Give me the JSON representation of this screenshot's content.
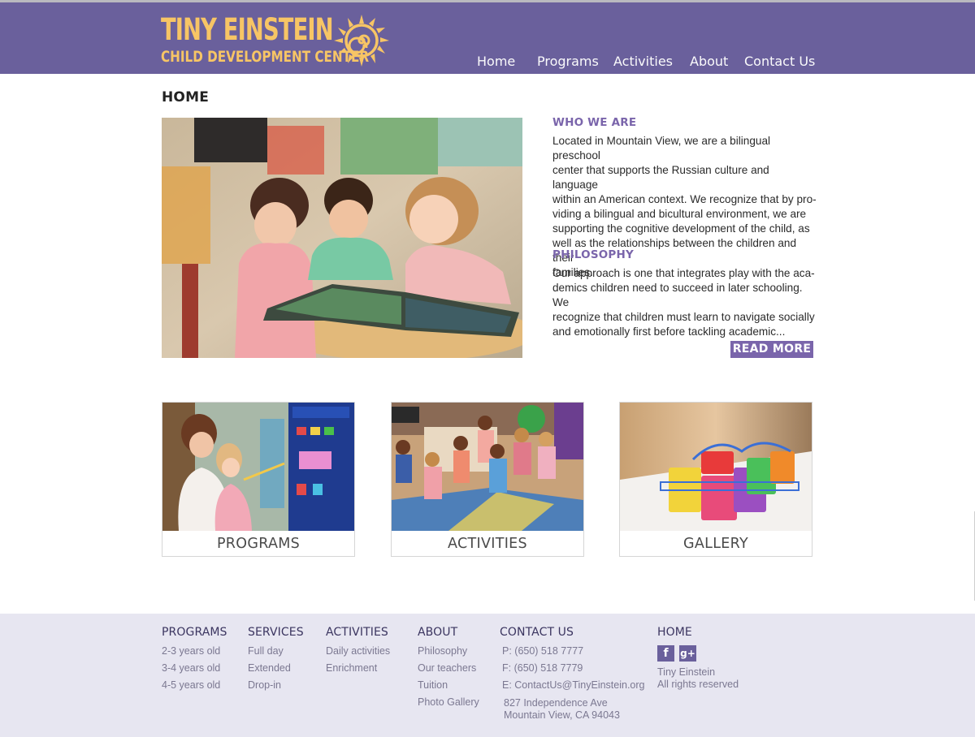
{
  "brand": {
    "name_line1": "TINY EINSTEIN",
    "name_line2": "CHILD DEVELOPMENT CENTER",
    "colors": {
      "header_bg": "#6a609c",
      "logo_gold": "#f7c565",
      "accent": "#7a65ab",
      "footer_bg": "#e7e6f1"
    }
  },
  "nav": {
    "items": [
      {
        "label": "Home"
      },
      {
        "label": "Programs"
      },
      {
        "label": "Activities"
      },
      {
        "label": "About"
      },
      {
        "label": "Contact Us"
      }
    ]
  },
  "main": {
    "title": "HOME",
    "who": {
      "heading": "WHO WE ARE",
      "lines": [
        "Located in Mountain View, we are a bilingual preschool",
        "center that supports the Russian culture and language",
        "within an American context. We recognize that by pro-",
        "viding a bilingual and bicultural environment, we are",
        "supporting the cognitive development of the child, as",
        "well as the relationships between the children and their",
        "families."
      ]
    },
    "philosophy": {
      "heading": "PHILOSOPHY",
      "lines": [
        "Our approach is one that integrates play with the aca-",
        "demics children need to succeed in later schooling. We",
        "recognize that children must learn to navigate socially",
        "and emotionally first before tackling academic..."
      ]
    },
    "read_more": "READ MORE",
    "cards": [
      {
        "label": "PROGRAMS"
      },
      {
        "label": "ACTIVITIES"
      },
      {
        "label": "GALLERY"
      }
    ]
  },
  "footer": {
    "programs": {
      "heading": "PROGRAMS",
      "links": [
        "2-3 years old",
        "3-4 years old",
        "4-5 years old"
      ]
    },
    "services": {
      "heading": "SERVICES",
      "links": [
        "Full day",
        "Extended",
        "Drop-in"
      ]
    },
    "activities": {
      "heading": "ACTIVITIES",
      "links": [
        "Daily activities",
        "Enrichment"
      ]
    },
    "about": {
      "heading": "ABOUT",
      "links": [
        "Philosophy",
        "Our teachers",
        "Tuition",
        "Photo Gallery"
      ]
    },
    "contact": {
      "heading": "CONTACT US",
      "phone": "P: (650) 518 7777",
      "fax": "F: (650) 518 7779",
      "email": "E: ContactUs@TinyEinstein.org",
      "address1": "827 Independence Ave",
      "address2": "Mountain View, CA 94043"
    },
    "home": {
      "heading": "HOME",
      "social": [
        {
          "icon": "facebook-icon",
          "glyph": "f"
        },
        {
          "icon": "google-plus-icon",
          "glyph": "g+"
        }
      ],
      "copy1": "Tiny Einstein",
      "copy2": "All rights reserved"
    }
  }
}
